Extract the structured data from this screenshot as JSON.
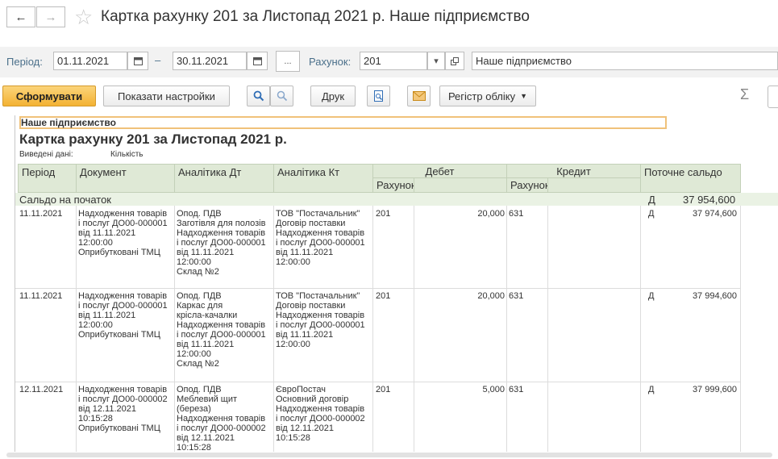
{
  "window": {
    "title": "Картка рахунку 201 за Листопад 2021 р. Наше підприємство"
  },
  "filters": {
    "period_label": "Період:",
    "date_from": "01.11.2021",
    "dash": "–",
    "date_to": "30.11.2021",
    "more_label": "...",
    "account_label": "Рахунок:",
    "account_value": "201",
    "organization_value": "Наше підприємство"
  },
  "toolbar": {
    "generate": "Сформувати",
    "show_settings": "Показати настройки",
    "print": "Друк",
    "register": "Регістр обліку"
  },
  "report": {
    "org": "Наше підприємство",
    "title": "Картка рахунку 201 за Листопад 2021 р.",
    "output_label": "Виведені дані:",
    "output_value": "Кількість",
    "headers": {
      "period": "Період",
      "document": "Документ",
      "analytics_dt": "Аналітика Дт",
      "analytics_kt": "Аналітика Кт",
      "debit": "Дебет",
      "credit": "Кредит",
      "balance": "Поточне сальдо",
      "account": "Рахунок",
      "account2": "Рахунок"
    },
    "opening": {
      "label": "Сальдо на початок",
      "side": "Д",
      "amount": "37 954,600"
    },
    "rows": [
      {
        "date": "11.11.2021",
        "doc": "Надходження товарів\nі послуг ДО00-000001\nвід 11.11.2021\n12:00:00\nОприбутковані ТМЦ",
        "dt": "Опод. ПДВ\nЗаготівля для полозів\nНадходження товарів\nі послуг ДО00-000001\nвід 11.11.2021\n12:00:00\nСклад №2",
        "kt": "ТОВ \"Постачальник\"\nДоговір поставки\nНадходження товарів\nі послуг ДО00-000001\nвід 11.11.2021\n12:00:00",
        "debit_account": "201",
        "debit_amount": "20,000",
        "credit_account": "631",
        "side": "Д",
        "balance": "37 974,600"
      },
      {
        "date": "11.11.2021",
        "doc": "Надходження товарів\nі послуг ДО00-000001\nвід 11.11.2021\n12:00:00\nОприбутковані ТМЦ",
        "dt": "Опод. ПДВ\nКаркас для\nкрісла-качалки\nНадходження товарів\nі послуг ДО00-000001\nвід 11.11.2021\n12:00:00\nСклад №2",
        "kt": "ТОВ \"Постачальник\"\nДоговір поставки\nНадходження товарів\nі послуг ДО00-000001\nвід 11.11.2021\n12:00:00",
        "debit_account": "201",
        "debit_amount": "20,000",
        "credit_account": "631",
        "side": "Д",
        "balance": "37 994,600"
      },
      {
        "date": "12.11.2021",
        "doc": "Надходження товарів\nі послуг ДО00-000002\nвід 12.11.2021\n10:15:28\nОприбутковані ТМЦ",
        "dt": "Опод. ПДВ\nМеблевий щит\n(береза)\nНадходження товарів\nі послуг ДО00-000002\nвід 12.11.2021\n10:15:28",
        "kt": "ЄвроПостач\nОсновний договір\nНадходження товарів\nі послуг ДО00-000002\nвід 12.11.2021\n10:15:28",
        "debit_account": "201",
        "debit_amount": "5,000",
        "credit_account": "631",
        "side": "Д",
        "balance": "37 999,600"
      }
    ]
  }
}
